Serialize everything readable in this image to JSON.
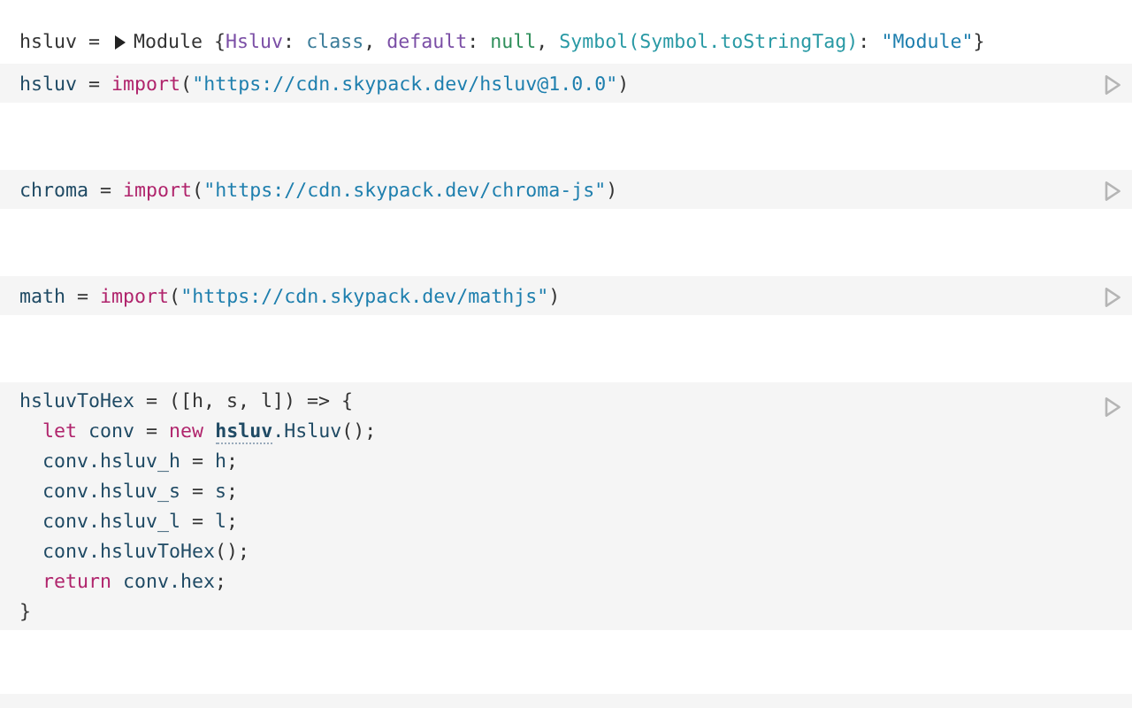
{
  "cells": [
    {
      "output": {
        "name": "hsluv =",
        "expanded": false,
        "tokens": [
          {
            "kind": "plain",
            "text": "Module {"
          },
          {
            "kind": "key",
            "text": "Hsluv"
          },
          {
            "kind": "plain",
            "text": ": "
          },
          {
            "kind": "type",
            "text": "class"
          },
          {
            "kind": "plain",
            "text": ", "
          },
          {
            "kind": "key",
            "text": "default"
          },
          {
            "kind": "plain",
            "text": ": "
          },
          {
            "kind": "null",
            "text": "null"
          },
          {
            "kind": "plain",
            "text": ", "
          },
          {
            "kind": "symbol",
            "text": "Symbol(Symbol.toStringTag)"
          },
          {
            "kind": "plain",
            "text": ": "
          },
          {
            "kind": "string",
            "text": "\"Module\""
          },
          {
            "kind": "plain",
            "text": "}"
          }
        ]
      },
      "lines": [
        [
          {
            "kind": "name",
            "text": "hsluv"
          },
          {
            "kind": "plain",
            "text": " = "
          },
          {
            "kind": "keyword",
            "text": "import"
          },
          {
            "kind": "plain",
            "text": "("
          },
          {
            "kind": "string",
            "text": "\"https://cdn.skypack.dev/hsluv@1.0.0\""
          },
          {
            "kind": "plain",
            "text": ")"
          }
        ]
      ]
    },
    {
      "lines": [
        [
          {
            "kind": "name",
            "text": "chroma"
          },
          {
            "kind": "plain",
            "text": " = "
          },
          {
            "kind": "keyword",
            "text": "import"
          },
          {
            "kind": "plain",
            "text": "("
          },
          {
            "kind": "string",
            "text": "\"https://cdn.skypack.dev/chroma-js\""
          },
          {
            "kind": "plain",
            "text": ")"
          }
        ]
      ]
    },
    {
      "lines": [
        [
          {
            "kind": "name",
            "text": "math"
          },
          {
            "kind": "plain",
            "text": " = "
          },
          {
            "kind": "keyword",
            "text": "import"
          },
          {
            "kind": "plain",
            "text": "("
          },
          {
            "kind": "string",
            "text": "\"https://cdn.skypack.dev/mathjs\""
          },
          {
            "kind": "plain",
            "text": ")"
          }
        ]
      ]
    },
    {
      "lines": [
        [
          {
            "kind": "name",
            "text": "hsluvToHex"
          },
          {
            "kind": "plain",
            "text": " = ([h, s, l]) => {"
          }
        ],
        [
          {
            "kind": "keyword",
            "text": "  let"
          },
          {
            "kind": "name",
            "text": " conv"
          },
          {
            "kind": "plain",
            "text": " = "
          },
          {
            "kind": "keyword",
            "text": "new "
          },
          {
            "kind": "ref",
            "text": "hsluv"
          },
          {
            "kind": "name",
            "text": ".Hsluv"
          },
          {
            "kind": "plain",
            "text": "();"
          }
        ],
        [
          {
            "kind": "name",
            "text": "  conv.hsluv_h"
          },
          {
            "kind": "plain",
            "text": " = "
          },
          {
            "kind": "name",
            "text": "h"
          },
          {
            "kind": "plain",
            "text": ";"
          }
        ],
        [
          {
            "kind": "name",
            "text": "  conv.hsluv_s"
          },
          {
            "kind": "plain",
            "text": " = "
          },
          {
            "kind": "name",
            "text": "s"
          },
          {
            "kind": "plain",
            "text": ";"
          }
        ],
        [
          {
            "kind": "name",
            "text": "  conv.hsluv_l"
          },
          {
            "kind": "plain",
            "text": " = "
          },
          {
            "kind": "name",
            "text": "l"
          },
          {
            "kind": "plain",
            "text": ";"
          }
        ],
        [
          {
            "kind": "name",
            "text": "  conv.hsluvToHex"
          },
          {
            "kind": "plain",
            "text": "();"
          }
        ],
        [
          {
            "kind": "keyword",
            "text": "  return"
          },
          {
            "kind": "name",
            "text": " conv.hex"
          },
          {
            "kind": "plain",
            "text": ";"
          }
        ],
        [
          {
            "kind": "plain",
            "text": "}"
          }
        ]
      ]
    }
  ]
}
